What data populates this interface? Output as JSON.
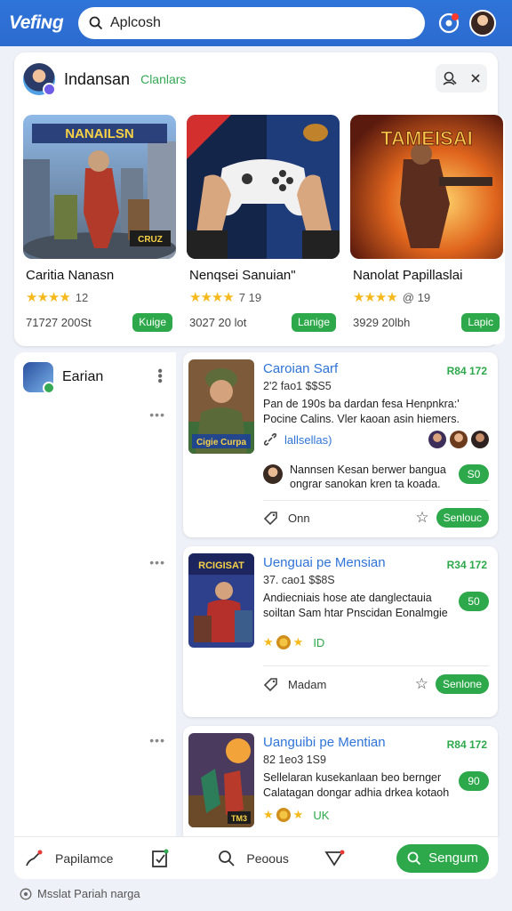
{
  "app": {
    "logo": "Vefiɴg"
  },
  "search": {
    "value": "Aplcosh"
  },
  "featured": {
    "title": "Indansan",
    "tag": "Clanlars",
    "games": [
      {
        "name": "Caritia Nanasn",
        "rating": "12",
        "meta": "71727 200St",
        "button": "Kuige",
        "art_text": "NANAILSN"
      },
      {
        "name": "Nenqsei Sanuian\"",
        "rating": "7 19",
        "meta": "3027 20 lot",
        "button": "Lanige",
        "art_text": ""
      },
      {
        "name": "Nanolat Papillaslai",
        "rating": "@ 19",
        "meta": "3929 20lbh",
        "button": "Lapic",
        "art_text": "TAMEISAI"
      }
    ]
  },
  "left_panel": {
    "title": "Earian"
  },
  "posts": [
    {
      "title": "Caroian Sarf",
      "price": "R84 172",
      "sub": "2'2 fao1 $$S5",
      "desc": "Pan de 190s ba dardan fesa Henpnkra:' Pocine Calins. Vler kaoan asin hiemers.",
      "link": "lallsellas)",
      "comment": "Nannsen Kesan berwer bangua ongrar sanokan kren ta koada.",
      "count": "S0",
      "foot_label": "Onn",
      "foot_button": "Senlouc",
      "art_text": "Cigie Curpa"
    },
    {
      "title": "Uenguai pe Mensian",
      "price": "R34 172",
      "sub": "37. cao1 $$8S",
      "desc": "Andiecniais hose ate danglectauia soiltan Sam htar Pnscidan Eonalmgie",
      "count": "50",
      "medal_label": "ID",
      "foot_label": "Madam",
      "foot_button": "Senlone",
      "art_text": "RCIGISAT"
    },
    {
      "title": "Uanguibi pe Mentian",
      "price": "R84 172",
      "sub": "82 1eo3 1S9",
      "desc": "Sellelaran kusekanlaan beo bernger Calatagan dongar adhia drkea kotaoh",
      "count": "90",
      "medal_label": "UK",
      "art_text": "TM3"
    }
  ],
  "bottom_bar": {
    "item1": "Papilamce",
    "item3": "Peoous",
    "main_button": "Sengum"
  },
  "footer": {
    "note": "Msslat Pariah narga"
  }
}
